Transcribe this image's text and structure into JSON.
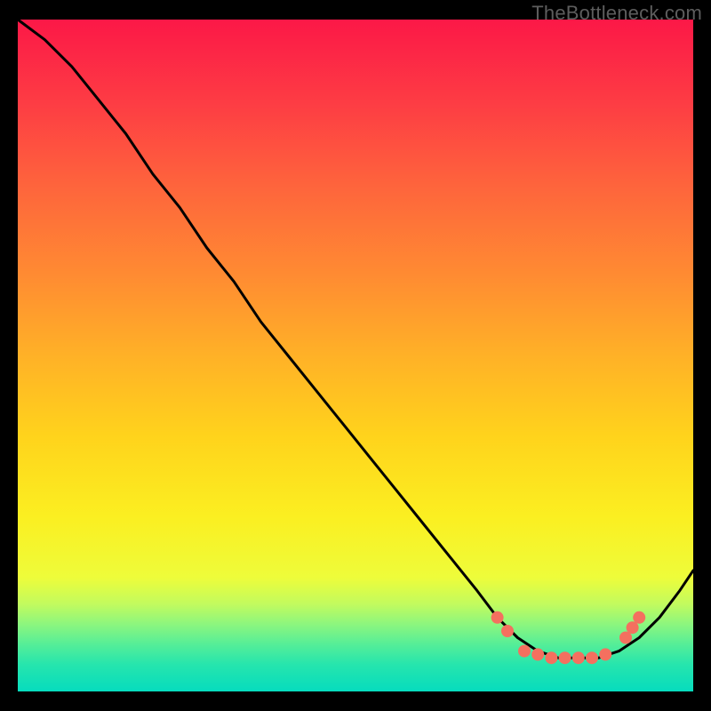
{
  "watermark": "TheBottleneck.com",
  "chart_data": {
    "type": "line",
    "title": "",
    "xlabel": "",
    "ylabel": "",
    "xlim": [
      0,
      100
    ],
    "ylim": [
      0,
      100
    ],
    "gradient_stops": [
      {
        "pos": 0,
        "color": "#fc1847"
      },
      {
        "pos": 12,
        "color": "#fd3b44"
      },
      {
        "pos": 25,
        "color": "#fe653c"
      },
      {
        "pos": 38,
        "color": "#ff8b32"
      },
      {
        "pos": 50,
        "color": "#ffb127"
      },
      {
        "pos": 62,
        "color": "#ffd31c"
      },
      {
        "pos": 74,
        "color": "#fbef21"
      },
      {
        "pos": 83,
        "color": "#eefc3a"
      },
      {
        "pos": 87,
        "color": "#c2fb5e"
      },
      {
        "pos": 90,
        "color": "#8cf67e"
      },
      {
        "pos": 93,
        "color": "#55ee98"
      },
      {
        "pos": 96,
        "color": "#26e5ad"
      },
      {
        "pos": 100,
        "color": "#06dcbe"
      }
    ],
    "series": [
      {
        "name": "bottleneck-curve",
        "x": [
          0,
          4,
          8,
          12,
          16,
          20,
          24,
          28,
          32,
          36,
          40,
          44,
          48,
          52,
          56,
          60,
          64,
          68,
          71,
          74,
          77,
          80,
          83,
          86,
          89,
          92,
          95,
          98,
          100
        ],
        "y": [
          100,
          97,
          93,
          88,
          83,
          77,
          72,
          66,
          61,
          55,
          50,
          45,
          40,
          35,
          30,
          25,
          20,
          15,
          11,
          8,
          6,
          5,
          5,
          5,
          6,
          8,
          11,
          15,
          18
        ]
      }
    ],
    "markers": {
      "name": "highlight-dots",
      "color": "#f4705f",
      "radius": 7,
      "points": [
        {
          "x": 71,
          "y": 11
        },
        {
          "x": 72.5,
          "y": 9
        },
        {
          "x": 75,
          "y": 6
        },
        {
          "x": 77,
          "y": 5.5
        },
        {
          "x": 79,
          "y": 5
        },
        {
          "x": 81,
          "y": 5
        },
        {
          "x": 83,
          "y": 5
        },
        {
          "x": 85,
          "y": 5
        },
        {
          "x": 87,
          "y": 5.5
        },
        {
          "x": 90,
          "y": 8
        },
        {
          "x": 91,
          "y": 9.5
        },
        {
          "x": 92,
          "y": 11
        }
      ]
    }
  }
}
